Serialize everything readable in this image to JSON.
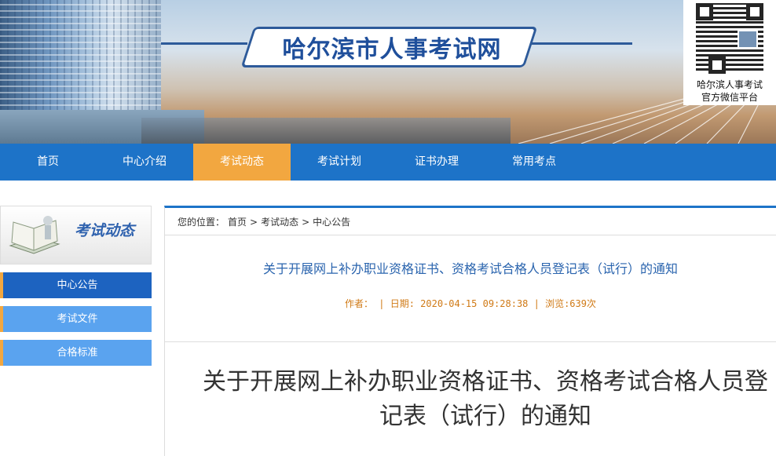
{
  "header": {
    "site_title": "哈尔滨市人事考试网",
    "qr_caption_line1": "哈尔滨人事考试",
    "qr_caption_line2": "官方微信平台"
  },
  "nav": {
    "items": [
      {
        "label": "首页"
      },
      {
        "label": "中心介绍"
      },
      {
        "label": "考试动态"
      },
      {
        "label": "考试计划"
      },
      {
        "label": "证书办理"
      },
      {
        "label": "常用考点"
      }
    ],
    "active": "考试动态"
  },
  "sidebar": {
    "title": "考试动态",
    "items": [
      {
        "label": "中心公告",
        "color": "#1d63c0"
      },
      {
        "label": "考试文件",
        "color": "#5aa3ef"
      },
      {
        "label": "合格标准",
        "color": "#5aa3ef"
      }
    ]
  },
  "breadcrumb": {
    "prefix": "您的位置：",
    "items": [
      "首页",
      "考试动态",
      "中心公告"
    ],
    "separator": ">"
  },
  "article": {
    "title": "关于开展网上补办职业资格证书、资格考试合格人员登记表（试行）的通知",
    "meta": "作者：  | 日期: 2020-04-15 09:28:38 | 浏览:639次",
    "heading_line1": "关于开展网上补办职业资格证书、资格考试合格人员登",
    "heading_line2": "记表（试行）的通知"
  },
  "colors": {
    "nav_blue": "#1d73c8",
    "active_orange": "#f2a740",
    "title_blue": "#2a64ae"
  }
}
